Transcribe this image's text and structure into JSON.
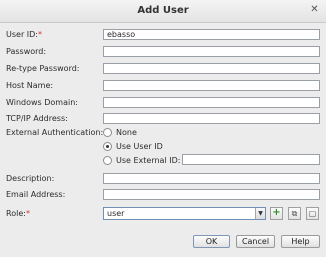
{
  "window": {
    "title": "Add User",
    "close_glyph": "✕"
  },
  "form": {
    "user_id": {
      "label": "User ID:",
      "required_mark": "*",
      "value": "ebasso"
    },
    "password": {
      "label": "Password:",
      "value": ""
    },
    "retype_password": {
      "label": "Re-type Password:",
      "value": ""
    },
    "host_name": {
      "label": "Host Name:",
      "value": ""
    },
    "windows_domain": {
      "label": "Windows Domain:",
      "value": ""
    },
    "tcpip_address": {
      "label": "TCP/IP Address:",
      "value": ""
    },
    "external_auth": {
      "label": "External Authentication:",
      "options": [
        {
          "label": "None",
          "selected": false
        },
        {
          "label": "Use User ID",
          "selected": true
        },
        {
          "label": "Use External ID:",
          "selected": false
        }
      ],
      "external_id_value": ""
    },
    "description": {
      "label": "Description:",
      "value": ""
    },
    "email_address": {
      "label": "Email Address:",
      "value": ""
    },
    "role": {
      "label": "Role:",
      "required_mark": "*",
      "value": "user",
      "dropdown_glyph": "▼",
      "add_glyph": "+",
      "copy_glyph": "⧉",
      "browse_glyph": "▢"
    }
  },
  "buttons": {
    "ok": "OK",
    "cancel": "Cancel",
    "help": "Help"
  },
  "icons": {
    "close": "close-icon",
    "add": "plus-icon",
    "copy": "copy-icon",
    "browse": "window-icon",
    "dropdown": "chevron-down-icon"
  },
  "colors": {
    "required": "#d23a2a",
    "add_icon": "#2f8f2f",
    "focus_border": "#6f8fb4"
  }
}
